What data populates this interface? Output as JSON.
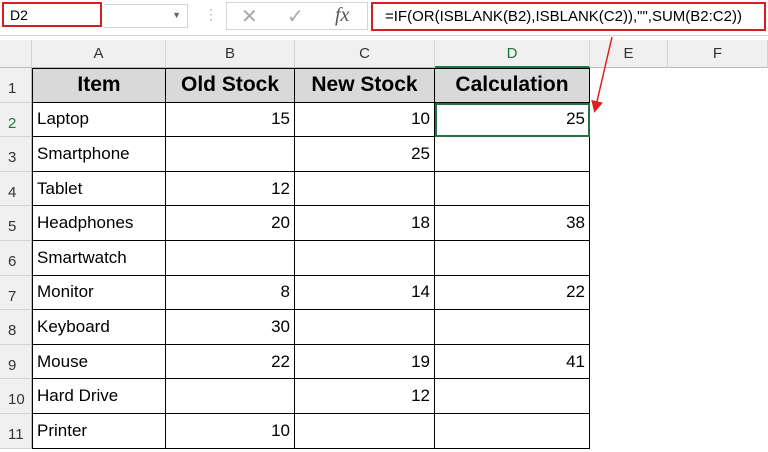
{
  "name_box": "D2",
  "formula": "=IF(OR(ISBLANK(B2),ISBLANK(C2)),\"\",SUM(B2:C2))",
  "fx_label": "fx",
  "cancel_icon": "✕",
  "enter_icon": "✓",
  "columns": [
    "A",
    "B",
    "C",
    "D",
    "E",
    "F"
  ],
  "row_numbers": [
    "1",
    "2",
    "3",
    "4",
    "5",
    "6",
    "7",
    "8",
    "9",
    "10",
    "11"
  ],
  "headers": [
    "Item",
    "Old Stock",
    "New Stock",
    "Calculation"
  ],
  "rows": [
    [
      "Laptop",
      "15",
      "10",
      "25"
    ],
    [
      "Smartphone",
      "",
      "25",
      ""
    ],
    [
      "Tablet",
      "12",
      "",
      ""
    ],
    [
      "Headphones",
      "20",
      "18",
      "38"
    ],
    [
      "Smartwatch",
      "",
      "",
      ""
    ],
    [
      "Monitor",
      "8",
      "14",
      "22"
    ],
    [
      "Keyboard",
      "30",
      "",
      ""
    ],
    [
      "Mouse",
      "22",
      "19",
      "41"
    ],
    [
      "Hard Drive",
      "",
      "12",
      ""
    ],
    [
      "Printer",
      "10",
      "",
      ""
    ]
  ],
  "colors": {
    "highlight": "#d42020",
    "selection": "#217346"
  }
}
